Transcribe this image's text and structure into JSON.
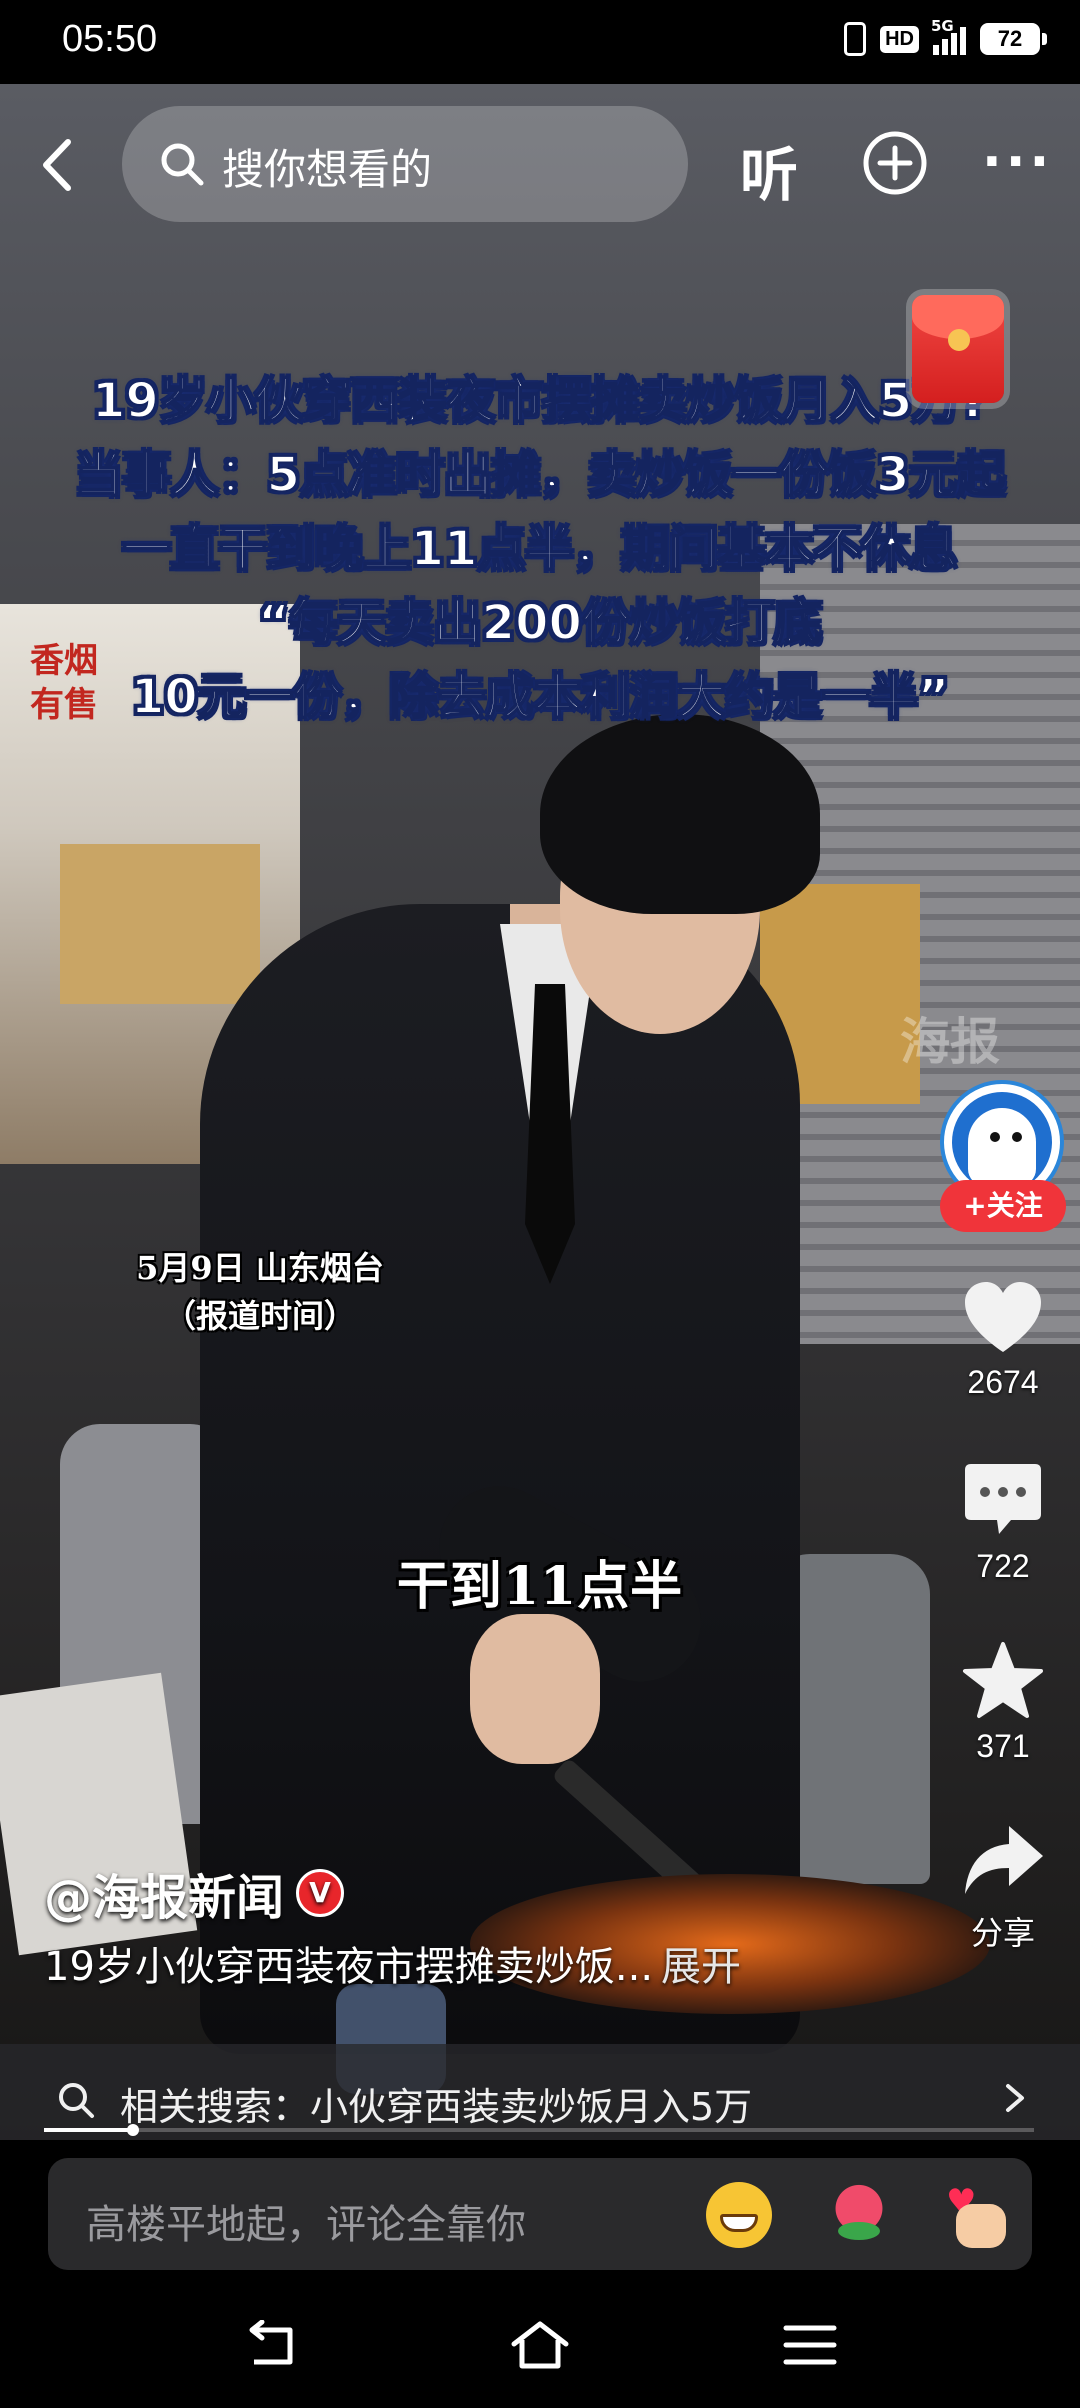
{
  "status_bar": {
    "time": "05:50",
    "hd": "HD",
    "network": "5G",
    "battery": "72"
  },
  "top_bar": {
    "search_placeholder": "搜你想看的",
    "listen_label": "听",
    "more_label": "···"
  },
  "video": {
    "headline_lines": [
      "19岁小伙穿西装夜市摆摊卖炒饭月入5万?",
      "当事人：5点准时出摊，卖炒饭一份饭3元起",
      "一直干到晚上11点半，期间基本不休息",
      "“每天卖出200份炒饭打底",
      "10元一份，除去成本利润大约是一半”"
    ],
    "shop_sign": "香烟有售",
    "watermark": "海报",
    "date_caption_line1": "5月9日 山东烟台",
    "date_caption_line2": "（报道时间）",
    "subtitle": "干到11点半"
  },
  "rail": {
    "follow_label": "+关注",
    "like_count": "2674",
    "comment_count": "722",
    "favorite_count": "371",
    "share_label": "分享"
  },
  "info": {
    "author": "@海报新闻",
    "verified_mark": "V",
    "description": "19岁小伙穿西装夜市摆摊卖炒饭...",
    "expand_label": "展开"
  },
  "related_search": {
    "text": "相关搜索：小伙穿西装卖炒饭月入5万"
  },
  "progress": {
    "fraction": 0.09
  },
  "comment_bar": {
    "placeholder": "高楼平地起，评论全靠你"
  },
  "colors": {
    "accent_red": "#f0343a",
    "headline_outline": "#14245f"
  },
  "icons": {
    "back": "back-arrow-icon",
    "search": "search-icon",
    "plus": "plus-circle-icon",
    "like": "heart-icon",
    "comment": "comment-icon",
    "favorite": "star-icon",
    "share": "share-arrow-icon"
  }
}
